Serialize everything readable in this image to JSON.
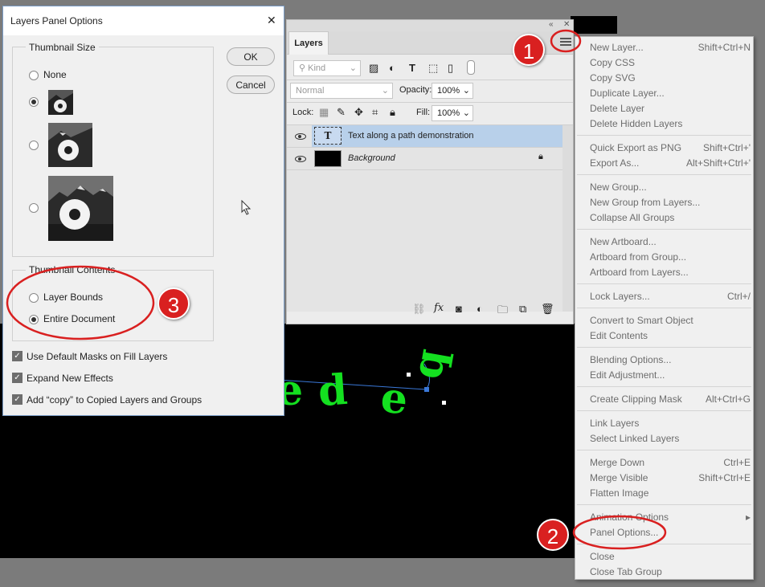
{
  "dialog": {
    "title": "Layers Panel Options",
    "close_glyph": "✕",
    "thumbnail_size": {
      "label": "Thumbnail Size",
      "none_label": "None"
    },
    "thumbnail_contents": {
      "label": "Thumbnail Contents",
      "options": [
        "Layer Bounds",
        "Entire Document"
      ],
      "selected": "Entire Document"
    },
    "checkboxes": [
      "Use Default Masks on Fill Layers",
      "Expand New Effects",
      "Add “copy” to Copied Layers and Groups"
    ],
    "ok_label": "OK",
    "cancel_label": "Cancel"
  },
  "layers_panel": {
    "collapse_glyph": "«",
    "close_glyph": "✕",
    "tab_label": "Layers",
    "filter_label": "Kind",
    "blend_mode": "Normal",
    "opacity_label": "Opacity:",
    "opacity_value": "100%",
    "lock_label": "Lock:",
    "fill_label": "Fill:",
    "fill_value": "100%",
    "layers": [
      {
        "name": "Text along a path demonstration",
        "type_glyph": "T",
        "selected": true
      },
      {
        "name": "Background",
        "locked": true
      }
    ],
    "footer_fx": "fx"
  },
  "menu": {
    "sections": [
      [
        [
          "New Layer...",
          "Shift+Ctrl+N"
        ],
        [
          "Copy CSS",
          ""
        ],
        [
          "Copy SVG",
          ""
        ],
        [
          "Duplicate Layer...",
          ""
        ],
        [
          "Delete Layer",
          ""
        ],
        [
          "Delete Hidden Layers",
          ""
        ]
      ],
      [
        [
          "Quick Export as PNG",
          "Shift+Ctrl+'"
        ],
        [
          "Export As...",
          "Alt+Shift+Ctrl+'"
        ]
      ],
      [
        [
          "New Group...",
          ""
        ],
        [
          "New Group from Layers...",
          ""
        ],
        [
          "Collapse All Groups",
          ""
        ]
      ],
      [
        [
          "New Artboard...",
          ""
        ],
        [
          "Artboard from Group...",
          ""
        ],
        [
          "Artboard from Layers...",
          ""
        ]
      ],
      [
        [
          "Lock Layers...",
          "Ctrl+/"
        ]
      ],
      [
        [
          "Convert to Smart Object",
          ""
        ],
        [
          "Edit Contents",
          ""
        ]
      ],
      [
        [
          "Blending Options...",
          ""
        ],
        [
          "Edit Adjustment...",
          ""
        ]
      ],
      [
        [
          "Create Clipping Mask",
          "Alt+Ctrl+G"
        ]
      ],
      [
        [
          "Link Layers",
          ""
        ],
        [
          "Select Linked Layers",
          ""
        ]
      ],
      [
        [
          "Merge Down",
          "Ctrl+E"
        ],
        [
          "Merge Visible",
          "Shift+Ctrl+E"
        ],
        [
          "Flatten Image",
          ""
        ]
      ],
      [
        [
          "Animation Options",
          "▸"
        ],
        [
          "Panel Options...",
          ""
        ]
      ],
      [
        [
          "Close",
          ""
        ],
        [
          "Close Tab Group",
          ""
        ]
      ]
    ]
  },
  "canvas_text": {
    "letters": [
      "e",
      "d",
      "e",
      "q"
    ]
  },
  "callouts": [
    "1",
    "2",
    "3"
  ],
  "colors": {
    "accent_red": "#d92020",
    "text_green": "#14e020",
    "selection_blue": "#b8d0ea"
  }
}
